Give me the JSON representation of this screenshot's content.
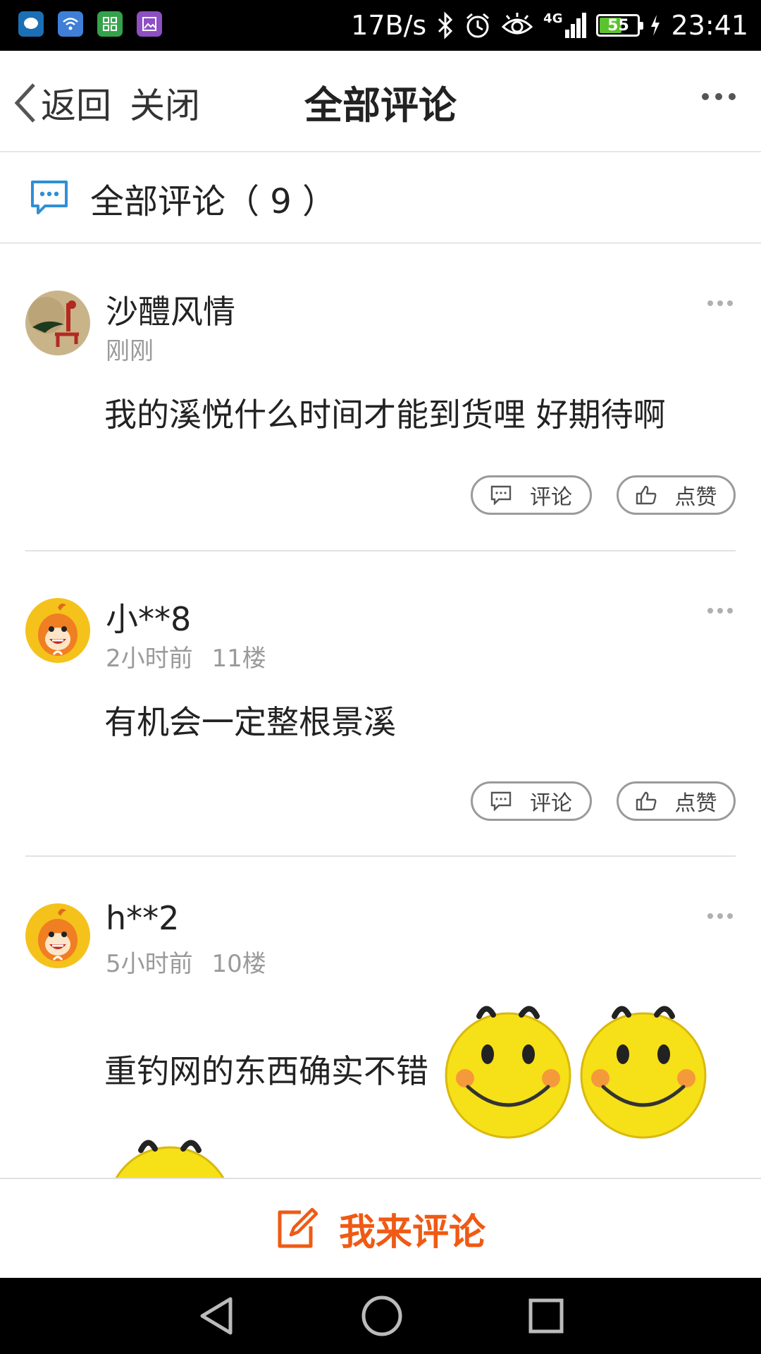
{
  "status_bar": {
    "net_speed": "17B/s",
    "network": "4G",
    "battery": "55",
    "time": "23:41"
  },
  "nav": {
    "back_label": "返回",
    "close_label": "关闭",
    "title": "全部评论"
  },
  "summary": {
    "label": "全部评论（ 9 ）"
  },
  "comments": [
    {
      "user": "沙醴风情",
      "time": "刚刚",
      "floor": "",
      "text": "我的溪悦什么时间才能到货哩 好期待啊",
      "reply_label": "评论",
      "like_label": "点赞"
    },
    {
      "user": "小**8",
      "time": "2小时前",
      "floor": "11楼",
      "text": "有机会一定整根景溪",
      "reply_label": "评论",
      "like_label": "点赞"
    },
    {
      "user": "h**2",
      "time": "5小时前",
      "floor": "10楼",
      "text": "重钓网的东西确实不错"
    }
  ],
  "bottom": {
    "write_label": "我来评论"
  },
  "colors": {
    "accent": "#ef5a14",
    "icon_blue": "#2f8fd6"
  }
}
